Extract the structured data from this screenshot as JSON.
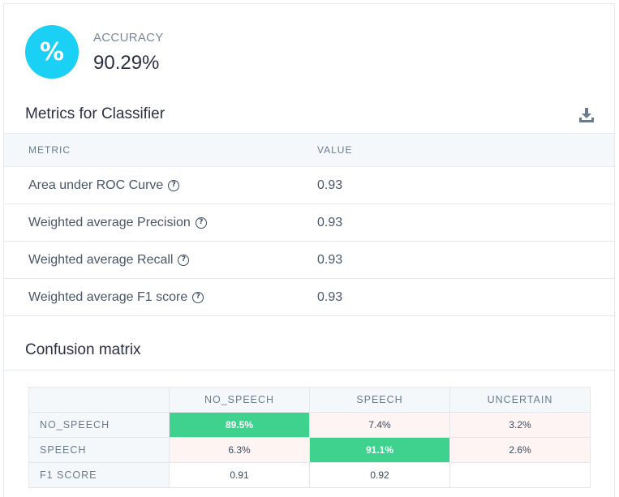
{
  "accuracy": {
    "icon": "%",
    "label": "ACCURACY",
    "value": "90.29%"
  },
  "metrics": {
    "title": "Metrics for Classifier",
    "download_icon": "download-icon",
    "columns": [
      "METRIC",
      "VALUE"
    ],
    "rows": [
      {
        "name": "Area under ROC Curve",
        "value": "0.93"
      },
      {
        "name": "Weighted average Precision",
        "value": "0.93"
      },
      {
        "name": "Weighted average Recall",
        "value": "0.93"
      },
      {
        "name": "Weighted average F1 score",
        "value": "0.93"
      }
    ]
  },
  "confusion": {
    "title": "Confusion matrix",
    "columns": [
      "NO_SPEECH",
      "SPEECH",
      "UNCERTAIN"
    ],
    "rows": [
      {
        "label": "NO_SPEECH",
        "cells": [
          "89.5%",
          "7.4%",
          "3.2%"
        ]
      },
      {
        "label": "SPEECH",
        "cells": [
          "6.3%",
          "91.1%",
          "2.6%"
        ]
      },
      {
        "label": "F1 SCORE",
        "cells": [
          "0.91",
          "0.92",
          ""
        ]
      }
    ],
    "colors": {
      "correct": "#3fd28e",
      "incorrect": "#fff4f4"
    }
  },
  "colors": {
    "accent": "#1ad0f5"
  }
}
